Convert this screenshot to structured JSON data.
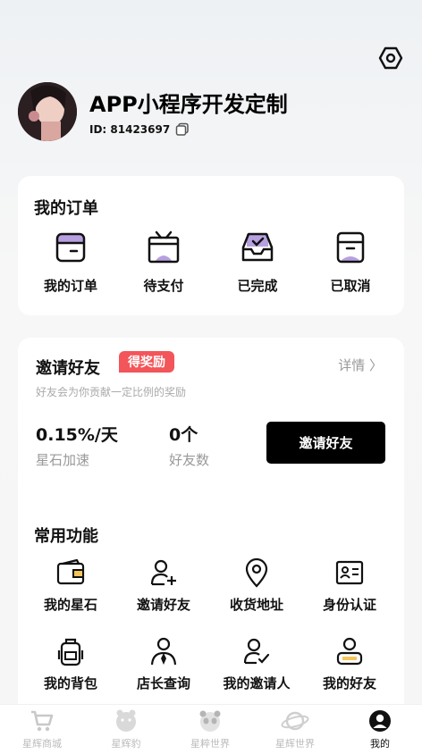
{
  "profile": {
    "name": "APP小程序开发定制",
    "id_label": "ID: 81423697"
  },
  "orders": {
    "title": "我的订单",
    "items": [
      {
        "label": "我的订单",
        "icon": "order-box-icon"
      },
      {
        "label": "待支付",
        "icon": "tv-pay-icon"
      },
      {
        "label": "已完成",
        "icon": "tray-check-icon"
      },
      {
        "label": "已取消",
        "icon": "archive-box-icon"
      }
    ]
  },
  "invite": {
    "title": "邀请好友",
    "badge": "得奖励",
    "detail": "详情 〉",
    "subtitle": "好友会为你贡献一定比例的奖励",
    "rate_value": "0.15%/天",
    "rate_label": "星石加速",
    "friends_value": "0个",
    "friends_label": "好友数",
    "button": "邀请好友"
  },
  "functions": {
    "title": "常用功能",
    "items": [
      {
        "label": "我的星石",
        "icon": "wallet-icon"
      },
      {
        "label": "邀请好友",
        "icon": "user-plus-icon"
      },
      {
        "label": "收货地址",
        "icon": "location-pin-icon"
      },
      {
        "label": "身份认证",
        "icon": "id-card-icon"
      },
      {
        "label": "我的背包",
        "icon": "backpack-icon"
      },
      {
        "label": "店长查询",
        "icon": "manager-tie-icon"
      },
      {
        "label": "我的邀请人",
        "icon": "user-check-icon"
      },
      {
        "label": "我的好友",
        "icon": "user-badge-icon"
      }
    ]
  },
  "tabbar": {
    "items": [
      {
        "label": "星辉商城",
        "icon": "cart-icon"
      },
      {
        "label": "星辉豹",
        "icon": "leopard-icon"
      },
      {
        "label": "星粹世界",
        "icon": "panda-icon"
      },
      {
        "label": "星辉世界",
        "icon": "planet-icon"
      },
      {
        "label": "我的",
        "icon": "profile-icon"
      }
    ],
    "active_index": 4
  },
  "colors": {
    "accent_purple": "#b7a0e0",
    "badge_red": "#f2555a",
    "button_black": "#000000"
  }
}
